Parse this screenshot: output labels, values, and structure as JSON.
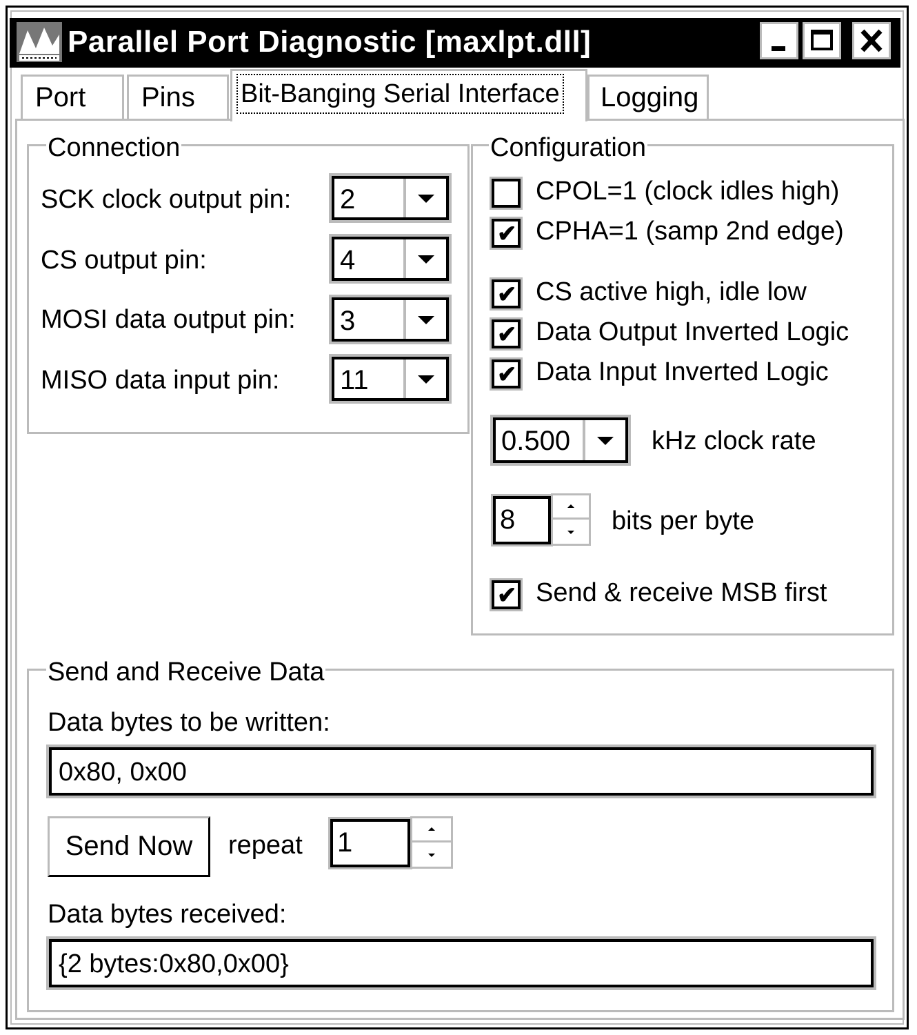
{
  "window": {
    "title": "Parallel Port Diagnostic [maxlpt.dll]",
    "app_icon": "maxim-logo-icon",
    "controls": [
      "minimize-icon",
      "maximize-icon",
      "close-icon"
    ]
  },
  "tabs": [
    {
      "label": "Port",
      "active": false
    },
    {
      "label": "Pins",
      "active": false
    },
    {
      "label": "Bit-Banging Serial Interface",
      "active": true
    },
    {
      "label": "Logging",
      "active": false
    }
  ],
  "connection": {
    "legend": "Connection",
    "fields": [
      {
        "label": "SCK clock output pin:",
        "value": "2"
      },
      {
        "label": "CS output pin:",
        "value": "4"
      },
      {
        "label": "MOSI data output pin:",
        "value": "3"
      },
      {
        "label": "MISO data input pin:",
        "value": "11"
      }
    ]
  },
  "configuration": {
    "legend": "Configuration",
    "checkboxes": [
      {
        "label": "CPOL=1 (clock idles high)",
        "checked": false
      },
      {
        "label": "CPHA=1 (samp 2nd edge)",
        "checked": true
      },
      {
        "label": "CS active high, idle low",
        "checked": true
      },
      {
        "label": "Data Output Inverted Logic",
        "checked": true
      },
      {
        "label": "Data Input Inverted Logic",
        "checked": true
      }
    ],
    "clock_rate": {
      "value": "0.500",
      "label": "kHz clock rate"
    },
    "bits_per_byte": {
      "value": "8",
      "label": "bits per byte"
    },
    "msb_first": {
      "label": "Send & receive MSB first",
      "checked": true
    }
  },
  "send_receive": {
    "legend": "Send and Receive Data",
    "write_label": "Data bytes to be written:",
    "write_value": "0x80, 0x00",
    "send_button": "Send Now",
    "repeat_label": "repeat",
    "repeat_value": "1",
    "received_label": "Data bytes received:",
    "received_value": "{2 bytes:0x80,0x00}"
  },
  "check_glyph": "✔"
}
